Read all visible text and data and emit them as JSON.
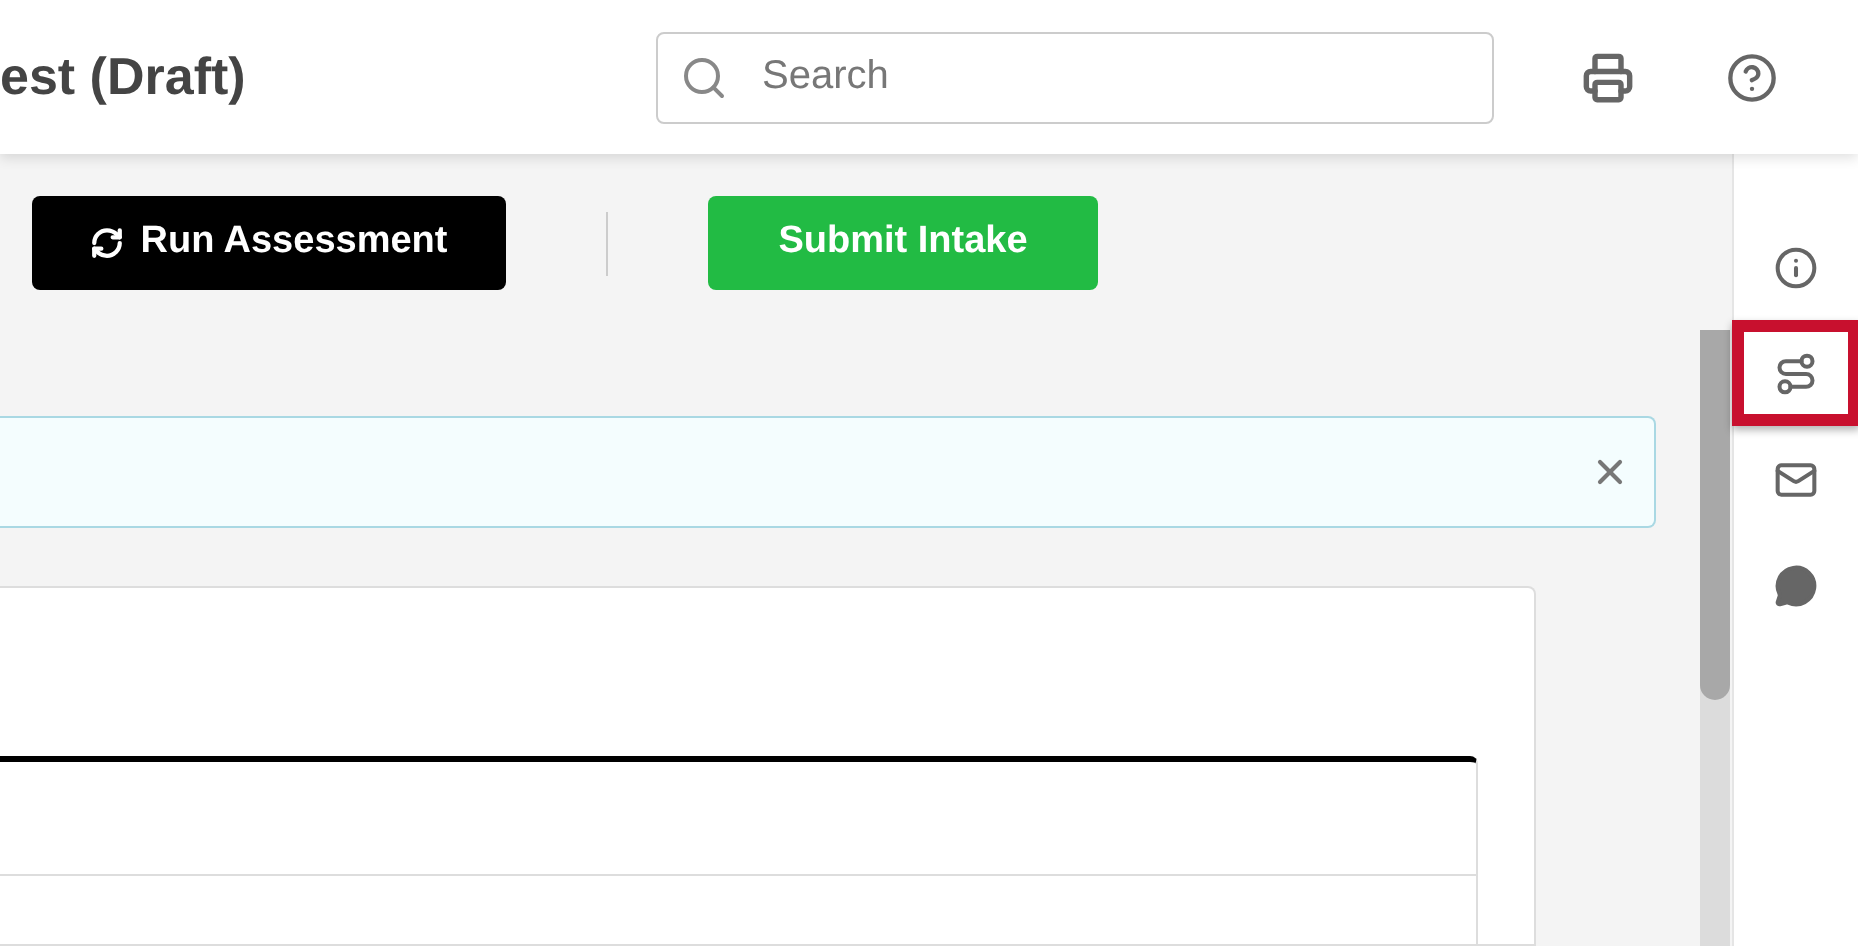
{
  "header": {
    "title": "est (Draft)",
    "search": {
      "placeholder": "Search"
    }
  },
  "toolbar": {
    "buttons": [
      {
        "label": "Run Assessment",
        "kind": "dark"
      },
      {
        "label": "Submit Intake",
        "kind": "success"
      }
    ]
  },
  "rail": {
    "items": [
      {
        "kind": "info",
        "selected": false
      },
      {
        "kind": "route",
        "selected": true
      },
      {
        "kind": "mail",
        "selected": false
      },
      {
        "kind": "chat",
        "selected": false
      }
    ]
  }
}
